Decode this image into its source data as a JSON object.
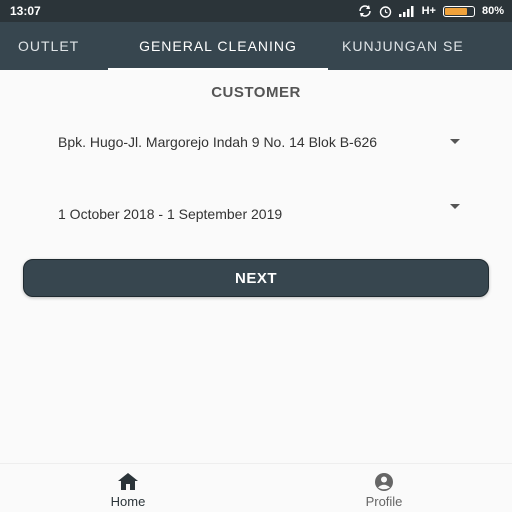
{
  "status_bar": {
    "time": "13:07",
    "network": "H+",
    "battery_percent": "80%",
    "battery_level": 0.8,
    "icons": [
      "data-sync-icon",
      "alarm-icon",
      "signal-icon",
      "battery-icon"
    ]
  },
  "tabs": [
    {
      "label": "OUTLET"
    },
    {
      "label": "GENERAL CLEANING",
      "active": true
    },
    {
      "label": "KUNJUNGAN SE"
    }
  ],
  "section": {
    "title": "CUSTOMER"
  },
  "customer_select": {
    "value": "Bpk. Hugo-Jl. Margorejo Indah 9 No. 14 Blok B-626"
  },
  "period_select": {
    "value": "1 October 2018 - 1 September 2019"
  },
  "next_button": {
    "label": "NEXT"
  },
  "bottom_nav": {
    "items": [
      {
        "label": "Home",
        "icon": "home-icon",
        "active": true
      },
      {
        "label": "Profile",
        "icon": "profile-icon"
      }
    ]
  },
  "colors": {
    "status_bar": "#2b3439",
    "app_bar": "#37464f",
    "button": "#37464f",
    "battery": "#f0a23b",
    "background": "#fafafa"
  }
}
